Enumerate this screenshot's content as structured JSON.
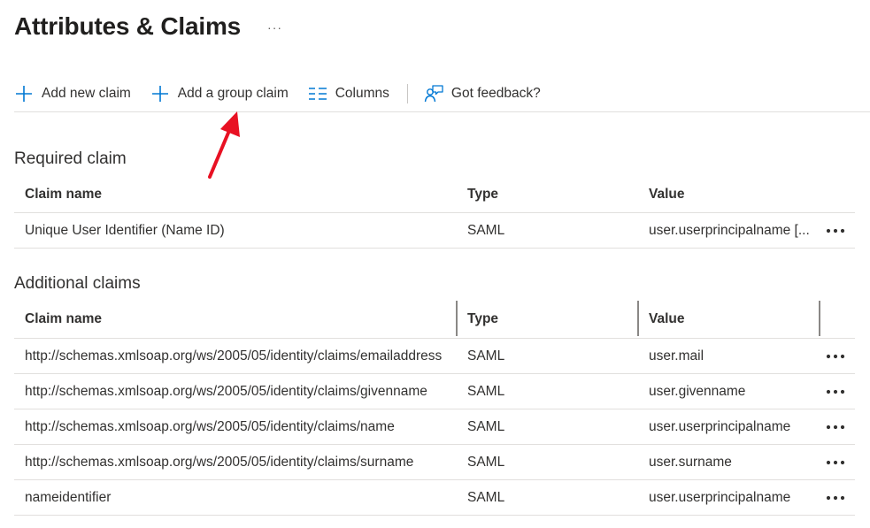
{
  "page": {
    "title": "Attributes & Claims",
    "more_label": "···"
  },
  "toolbar": {
    "add_claim": {
      "label": "Add new claim",
      "icon": "plus-icon"
    },
    "add_group_claim": {
      "label": "Add a group claim",
      "icon": "plus-icon"
    },
    "columns": {
      "label": "Columns",
      "icon": "columns-icon"
    },
    "feedback": {
      "label": "Got feedback?",
      "icon": "feedback-icon"
    }
  },
  "required": {
    "title": "Required claim",
    "headers": {
      "name": "Claim name",
      "type": "Type",
      "value": "Value"
    },
    "rows": [
      {
        "name": "Unique User Identifier (Name ID)",
        "type": "SAML",
        "value": "user.userprincipalname [..."
      }
    ]
  },
  "additional": {
    "title": "Additional claims",
    "headers": {
      "name": "Claim name",
      "type": "Type",
      "value": "Value"
    },
    "rows": [
      {
        "name": "http://schemas.xmlsoap.org/ws/2005/05/identity/claims/emailaddress",
        "type": "SAML",
        "value": "user.mail"
      },
      {
        "name": "http://schemas.xmlsoap.org/ws/2005/05/identity/claims/givenname",
        "type": "SAML",
        "value": "user.givenname"
      },
      {
        "name": "http://schemas.xmlsoap.org/ws/2005/05/identity/claims/name",
        "type": "SAML",
        "value": "user.userprincipalname"
      },
      {
        "name": "http://schemas.xmlsoap.org/ws/2005/05/identity/claims/surname",
        "type": "SAML",
        "value": "user.surname"
      },
      {
        "name": "nameidentifier",
        "type": "SAML",
        "value": "user.userprincipalname"
      }
    ]
  },
  "colors": {
    "accent": "#0078d4",
    "annotation_arrow": "#e81123"
  }
}
